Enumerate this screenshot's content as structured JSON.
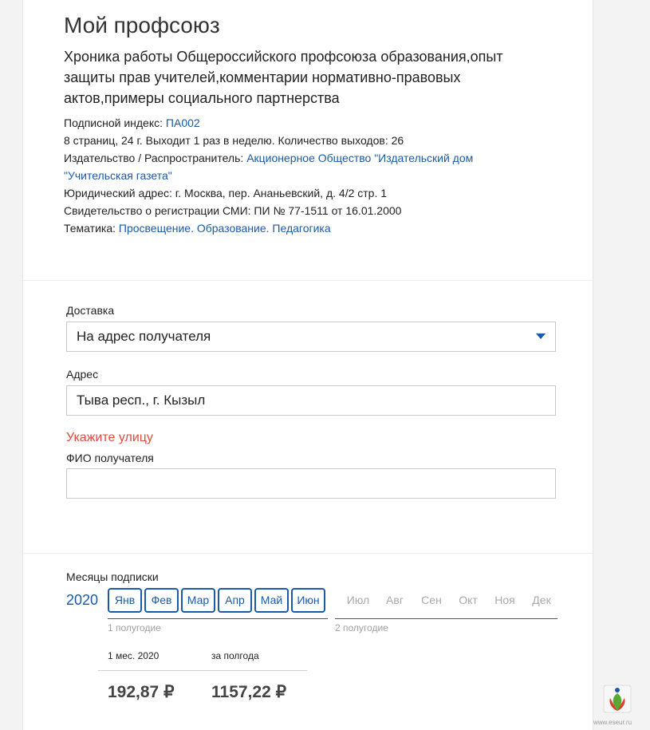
{
  "title": "Мой профсоюз",
  "subtitle": "Хроника работы Общероссийского профсоюза образования,опыт защиты прав учителей,комментарии нормативно-правовых актов,примеры социального партнерства",
  "meta": {
    "index_label": "Подписной индекс: ",
    "index_value": "ПА002",
    "pages_line": "8 страниц, 24 г. Выходит 1 раз в неделю. Количество выходов: 26",
    "publisher_label": "Издательство / Распространитель: ",
    "publisher_value": "Акционерное Общество \"Издательский дом \"Учительская газета\"",
    "address_line": "Юридический адрес: г. Москва, пер. Ананьевский, д. 4/2 стр. 1",
    "certificate_line": "Свидетельство о регистрации СМИ: ПИ № 77-1511 от 16.01.2000",
    "topic_label": "Тематика: ",
    "topic_value": "Просвещение. Образование. Педагогика"
  },
  "delivery": {
    "label": "Доставка",
    "value": "На адрес получателя"
  },
  "address": {
    "label": "Адрес",
    "value": "Тыва респ., г. Кызыл",
    "error": "Укажите улицу"
  },
  "recipient": {
    "label": "ФИО получателя",
    "value": ""
  },
  "subscription": {
    "label": "Месяцы подписки",
    "year": "2020",
    "first_half_months": [
      "Янв",
      "Фев",
      "Мар",
      "Апр",
      "Май",
      "Июн"
    ],
    "second_half_months": [
      "Июл",
      "Авг",
      "Сен",
      "Окт",
      "Ноя",
      "Дек"
    ],
    "first_half_label": "1 полугодие",
    "second_half_label": "2 полугодие"
  },
  "price": {
    "month_label": "1 мес. 2020",
    "half_label": "за полгода",
    "month_value": "192,87 ₽",
    "half_value": "1157,22 ₽"
  },
  "footer": {
    "logo_icon": "union-logo-icon",
    "logo_text": "www.eseur.ru",
    "colors": {
      "green": "#5aa832",
      "red": "#e23a2a",
      "blue": "#1a5aa8"
    }
  }
}
